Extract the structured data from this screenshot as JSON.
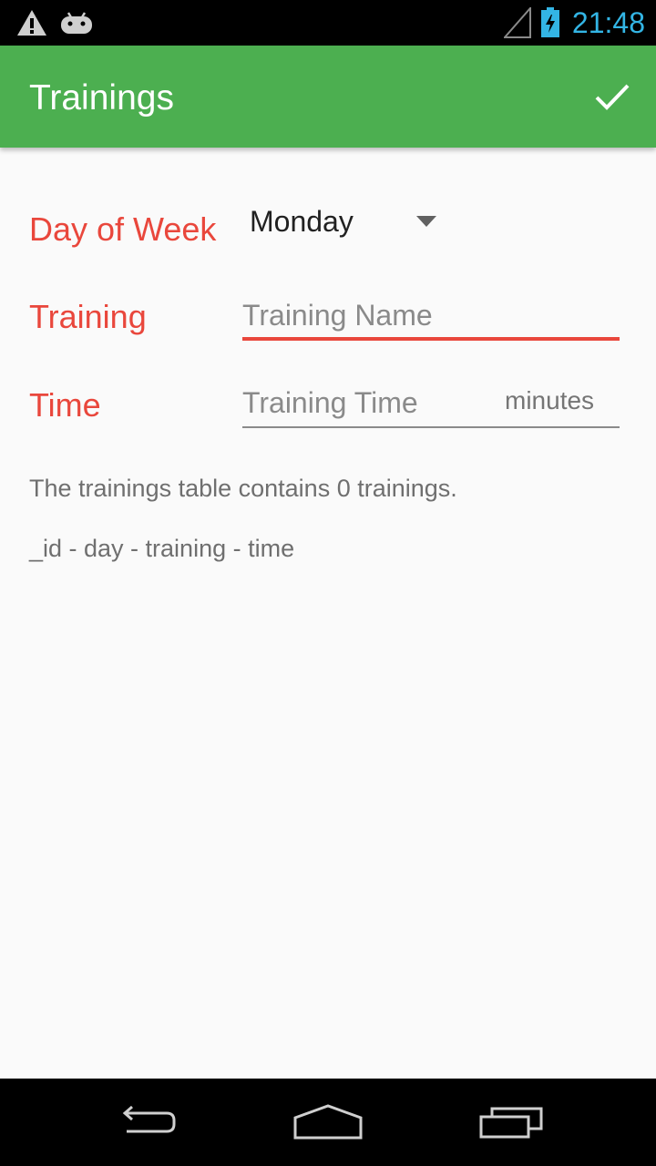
{
  "status_bar": {
    "time": "21:48",
    "icons": [
      "warning-icon",
      "android-debug-icon",
      "signal-icon",
      "battery-charging-icon"
    ],
    "clock_color": "#33b5e5"
  },
  "app_bar": {
    "title": "Trainings",
    "action_icon": "check-icon",
    "color": "#4caf50"
  },
  "form": {
    "day_label": "Day of Week",
    "day_value": "Monday",
    "training_label": "Training",
    "training_value": "",
    "training_placeholder": "Training Name",
    "time_label": "Time",
    "time_value": "",
    "time_placeholder": "Training Time",
    "time_unit": "minutes",
    "label_color": "#e9473c"
  },
  "info": {
    "count_text": "The trainings table contains 0 trainings.",
    "columns_text": "_id - day - training - time"
  },
  "nav_bar": {
    "icons": [
      "back-icon",
      "home-icon",
      "recents-icon"
    ]
  }
}
